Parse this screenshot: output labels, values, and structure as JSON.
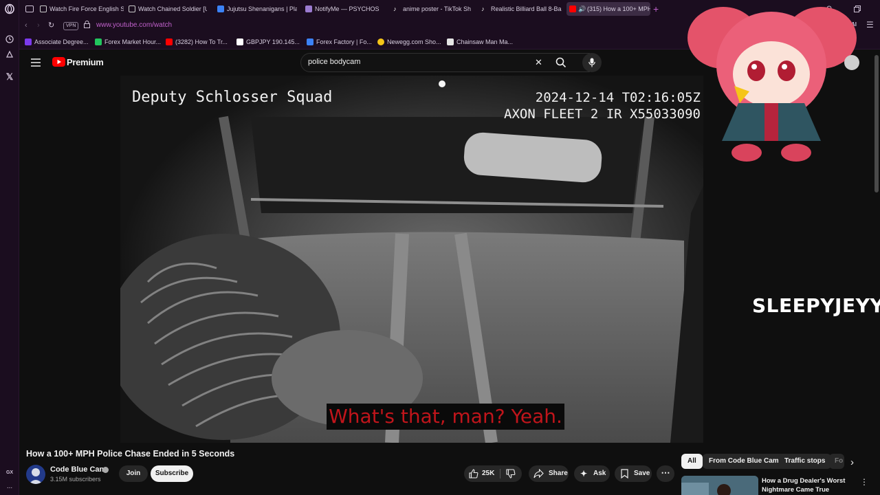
{
  "browser": {
    "tabs": [
      {
        "label": "Watch Fire Force English S",
        "icon_color": "#cccccc"
      },
      {
        "label": "Watch Chained Soldier [U",
        "icon_color": "#cccccc"
      },
      {
        "label": "Jujutsu Shenanigans | Pla",
        "icon_color": "#3b82f6"
      },
      {
        "label": "NotifyMe — PSYCHOS",
        "icon_color": "#9b7bd0"
      },
      {
        "label": "anime poster - TikTok Sh",
        "icon_color": "#ffffff"
      },
      {
        "label": "Realistic Billiard Ball 8-Ba",
        "icon_color": "#ffffff"
      },
      {
        "label": "(315) How a 100+ MPH",
        "icon_color": "#ff0000"
      }
    ],
    "url": "www.youtube.com/watch",
    "vpn_label": "VPN",
    "bookmarks": [
      {
        "label": "Associate Degree...",
        "icon_color": "#7c3aed"
      },
      {
        "label": "Forex Market Hour...",
        "icon_color": "#22c55e"
      },
      {
        "label": "(3282) How To Tr...",
        "icon_color": "#ff0000"
      },
      {
        "label": "GBPJPY 190.145...",
        "icon_color": "#ffffff"
      },
      {
        "label": "Forex Factory | Fo...",
        "icon_color": "#3b82f6"
      },
      {
        "label": "Newegg.com Sho...",
        "icon_color": "#f5c518"
      },
      {
        "label": "Chainsaw Man Ma...",
        "icon_color": "#e5e5e5"
      }
    ],
    "sidebar_labels": {
      "gx": "GX",
      "more": "..."
    }
  },
  "youtube": {
    "logo_text": "Premium",
    "search_value": "police bodycam",
    "video": {
      "overlay_left": "Deputy Schlosser Squad",
      "overlay_timestamp": "2024-12-14 T02:16:05Z",
      "overlay_device": "AXON FLEET 2 IR X55033090",
      "caption": "What's that, man? Yeah.",
      "streamer_name": "SLEEPYJEYY"
    },
    "title": "How a 100+ MPH Police Chase Ended in 5 Seconds",
    "channel": {
      "name": "Code Blue Cam",
      "subscribers": "3.15M subscribers",
      "join_label": "Join",
      "subscribe_label": "Subscribe"
    },
    "actions": {
      "likes": "25K",
      "share": "Share",
      "ask": "Ask",
      "save": "Save"
    },
    "chips": [
      "All",
      "From Code Blue Cam",
      "Traffic stops",
      "Fo"
    ],
    "recommendation": {
      "title_line1": "How a Drug Dealer's Worst",
      "title_line2": "Nightmare Came True"
    }
  },
  "colors": {
    "accent": "#c061cb",
    "youtube_red": "#ff0000",
    "caption_red": "#c0151b",
    "browser_bg": "#1b0d1f"
  }
}
